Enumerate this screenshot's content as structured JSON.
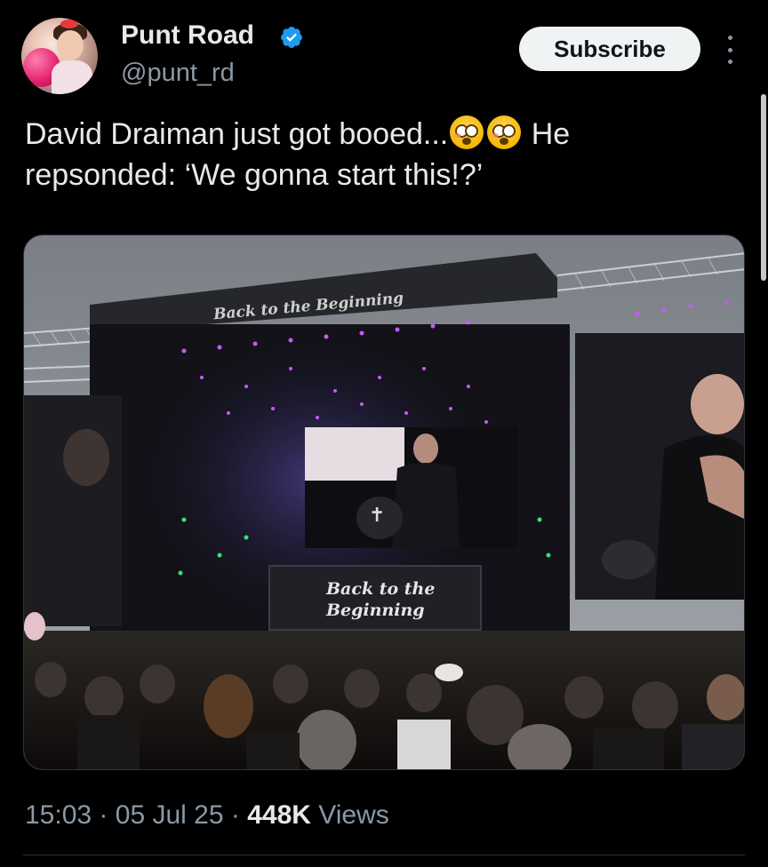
{
  "author": {
    "name": "Punt Road",
    "handle": "@punt_rd",
    "verified": true
  },
  "actions": {
    "subscribe_label": "Subscribe"
  },
  "tweet": {
    "text_part1": "David Draiman just got booed...",
    "text_part2": " He repsonded: ‘We gonna start this!?’",
    "emoji": "flushed-face"
  },
  "media": {
    "stage_banner_top": "Back to the Beginning",
    "stage_banner_front_line1": "Back to the",
    "stage_banner_front_line2": "Beginning"
  },
  "meta": {
    "time": "15:03",
    "date": "05 Jul 25",
    "views_count": "448K",
    "views_label": "Views",
    "separator": "·"
  },
  "colors": {
    "background": "#000000",
    "text_primary": "#e7e9ea",
    "text_secondary": "#8b98a5",
    "verified_badge": "#1d9bf0",
    "subscribe_bg": "#eff3f4"
  }
}
